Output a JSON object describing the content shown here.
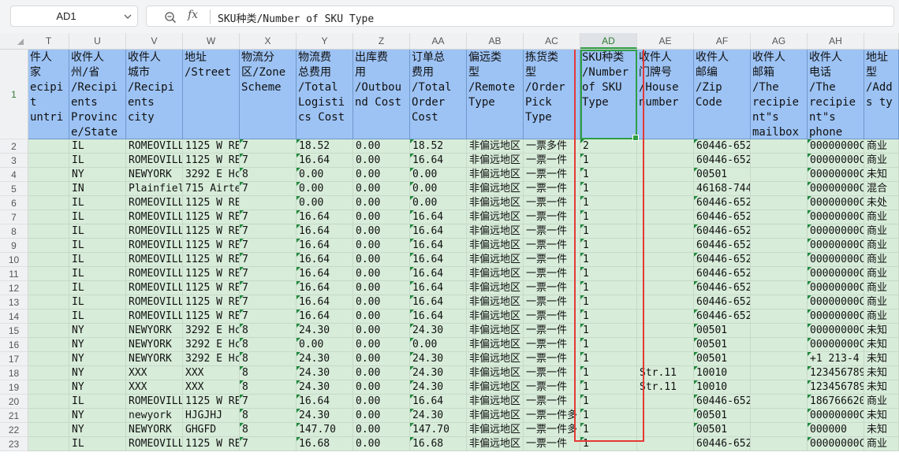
{
  "formula_bar": {
    "name_box": "AD1",
    "fx_label": "fx",
    "content": "SKU种类/Number of SKU Type"
  },
  "columns": [
    "T",
    "U",
    "V",
    "W",
    "X",
    "Y",
    "Z",
    "AA",
    "AB",
    "AC",
    "AD",
    "AE",
    "AF",
    "AG",
    "AH",
    ""
  ],
  "selected_column": "AD",
  "row_numbers": [
    "1",
    "2",
    "3",
    "4",
    "5",
    "6",
    "7",
    "8",
    "9",
    "10",
    "11",
    "12",
    "13",
    "14",
    "15",
    "16",
    "17",
    "18",
    "19",
    "20",
    "21",
    "22",
    "23"
  ],
  "headers": [
    [
      "件人",
      "家",
      "ecipi",
      "t",
      "untri"
    ],
    [
      "收件人",
      "州/省",
      "/Recipi",
      "ents",
      "Provinc",
      "e/State"
    ],
    [
      "收件人",
      "城市",
      "/Recipi",
      "ents",
      "city"
    ],
    [
      "地址",
      "/Street"
    ],
    [
      "物流分",
      "区/Zone",
      "Scheme"
    ],
    [
      "物流费",
      "总费用",
      "/Total",
      "Logisti",
      "cs Cost"
    ],
    [
      "出库费",
      "用",
      "/Outbou",
      "nd Cost"
    ],
    [
      "订单总",
      "费用",
      "/Total",
      "Order",
      "Cost"
    ],
    [
      "偏远类",
      "型",
      "/Remote",
      "Type"
    ],
    [
      "拣货类",
      "型",
      "/Order",
      "Pick",
      "Type"
    ],
    [
      "SKU种类",
      "/Number",
      "of SKU",
      "Type"
    ],
    [
      "收件人",
      "门牌号",
      "/House",
      "number"
    ],
    [
      "收件人",
      "邮编",
      "/Zip",
      "Code"
    ],
    [
      "收件人",
      "邮箱",
      "/The",
      "recipie",
      "nt\"s",
      "mailbox"
    ],
    [
      "收件人",
      "电话",
      "/The",
      "recipie",
      "nt\"s",
      "phone"
    ],
    [
      "地址",
      "型",
      "/Add",
      "s ty"
    ]
  ],
  "rows": [
    [
      "",
      "IL",
      "ROMEOVILL",
      "1125 W RE",
      "7",
      "18.52",
      "0.00",
      "18.52",
      "非偏远地区",
      "一票多件",
      "2",
      "",
      "60446-652",
      "",
      "00000000C",
      "商业"
    ],
    [
      "",
      "IL",
      "ROMEOVILL",
      "1125 W RE",
      "7",
      "16.64",
      "0.00",
      "16.64",
      "非偏远地区",
      "一票一件",
      "1",
      "",
      "60446-652",
      "",
      "00000000C",
      "商业"
    ],
    [
      "",
      "NY",
      "NEWYORK",
      "3292 E Hc",
      "8",
      "0.00",
      "0.00",
      "0.00",
      "非偏远地区",
      "一票一件",
      "1",
      "",
      "00501",
      "",
      "00000000C",
      "未知"
    ],
    [
      "",
      "IN",
      "Plainfiel",
      "715 Airte",
      "7",
      "0.00",
      "0.00",
      "0.00",
      "非偏远地区",
      "一票一件",
      "1",
      "",
      "46168-744",
      "",
      "00000000C",
      "混合"
    ],
    [
      "",
      "IL",
      "ROMEOVILL",
      "1125 W RE",
      "",
      "0.00",
      "0.00",
      "0.00",
      "非偏远地区",
      "一票一件",
      "1",
      "",
      "60446-652",
      "",
      "00000000C",
      "未处"
    ],
    [
      "",
      "IL",
      "ROMEOVILL",
      "1125 W RE",
      "7",
      "16.64",
      "0.00",
      "16.64",
      "非偏远地区",
      "一票一件",
      "1",
      "",
      "60446-652",
      "",
      "00000000C",
      "商业"
    ],
    [
      "",
      "IL",
      "ROMEOVILL",
      "1125 W RE",
      "7",
      "16.64",
      "0.00",
      "16.64",
      "非偏远地区",
      "一票一件",
      "1",
      "",
      "60446-652",
      "",
      "00000000C",
      "商业"
    ],
    [
      "",
      "IL",
      "ROMEOVILL",
      "1125 W RE",
      "7",
      "16.64",
      "0.00",
      "16.64",
      "非偏远地区",
      "一票一件",
      "1",
      "",
      "60446-652",
      "",
      "00000000C",
      "商业"
    ],
    [
      "",
      "IL",
      "ROMEOVILL",
      "1125 W RE",
      "7",
      "16.64",
      "0.00",
      "16.64",
      "非偏远地区",
      "一票一件",
      "1",
      "",
      "60446-652",
      "",
      "00000000C",
      "商业"
    ],
    [
      "",
      "IL",
      "ROMEOVILL",
      "1125 W RE",
      "7",
      "16.64",
      "0.00",
      "16.64",
      "非偏远地区",
      "一票一件",
      "1",
      "",
      "60446-652",
      "",
      "00000000C",
      "商业"
    ],
    [
      "",
      "IL",
      "ROMEOVILL",
      "1125 W RE",
      "7",
      "16.64",
      "0.00",
      "16.64",
      "非偏远地区",
      "一票一件",
      "1",
      "",
      "60446-652",
      "",
      "00000000C",
      "商业"
    ],
    [
      "",
      "IL",
      "ROMEOVILL",
      "1125 W RE",
      "7",
      "16.64",
      "0.00",
      "16.64",
      "非偏远地区",
      "一票一件",
      "1",
      "",
      "60446-652",
      "",
      "00000000C",
      "商业"
    ],
    [
      "",
      "IL",
      "ROMEOVILL",
      "1125 W RE",
      "7",
      "16.64",
      "0.00",
      "16.64",
      "非偏远地区",
      "一票一件",
      "1",
      "",
      "60446-652",
      "",
      "00000000C",
      "商业"
    ],
    [
      "",
      "NY",
      "NEWYORK",
      "3292 E Hc",
      "8",
      "24.30",
      "0.00",
      "24.30",
      "非偏远地区",
      "一票一件",
      "1",
      "",
      "00501",
      "",
      "00000000C",
      "未知"
    ],
    [
      "",
      "NY",
      "NEWYORK",
      "3292 E Hc",
      "8",
      "0.00",
      "0.00",
      "0.00",
      "非偏远地区",
      "一票一件",
      "1",
      "",
      "00501",
      "",
      "00000000C",
      "未知"
    ],
    [
      "",
      "NY",
      "NEWYORK",
      "3292 E Hc",
      "8",
      "24.30",
      "0.00",
      "24.30",
      "非偏远地区",
      "一票一件",
      "1",
      "",
      "00501",
      "",
      "+1 213-4",
      "未知"
    ],
    [
      "",
      "NY",
      "XXX",
      "XXX",
      "8",
      "24.30",
      "0.00",
      "24.30",
      "非偏远地区",
      "一票一件",
      "1",
      "Str.11",
      "10010",
      "",
      "123456789",
      "未知"
    ],
    [
      "",
      "NY",
      "XXX",
      "XXX",
      "8",
      "24.30",
      "0.00",
      "24.30",
      "非偏远地区",
      "一票一件",
      "1",
      "Str.11",
      "10010",
      "",
      "123456789",
      "未知"
    ],
    [
      "",
      "IL",
      "ROMEOVILL",
      "1125 W RE",
      "7",
      "16.64",
      "0.00",
      "16.64",
      "非偏远地区",
      "一票一件",
      "1",
      "",
      "60446-652",
      "",
      "186766620",
      "商业"
    ],
    [
      "",
      "NY",
      "newyork",
      "HJGJHJ",
      "8",
      "24.30",
      "0.00",
      "24.30",
      "非偏远地区",
      "一票一件多",
      "1",
      "",
      "00501",
      "",
      "00000000C",
      "未知"
    ],
    [
      "",
      "NY",
      "NEWYORK",
      "GHGFD",
      "8",
      "147.70",
      "0.00",
      "147.70",
      "非偏远地区",
      "一票一件多",
      "1",
      "",
      "00501",
      "",
      "000000",
      "未知"
    ],
    [
      "",
      "IL",
      "ROMEOVILL",
      "1125 W RE",
      "7",
      "16.68",
      "0.00",
      "16.68",
      "非偏远地区",
      "一票一件",
      "1",
      "",
      "60446-652",
      "",
      "00000000C",
      "商业"
    ]
  ]
}
